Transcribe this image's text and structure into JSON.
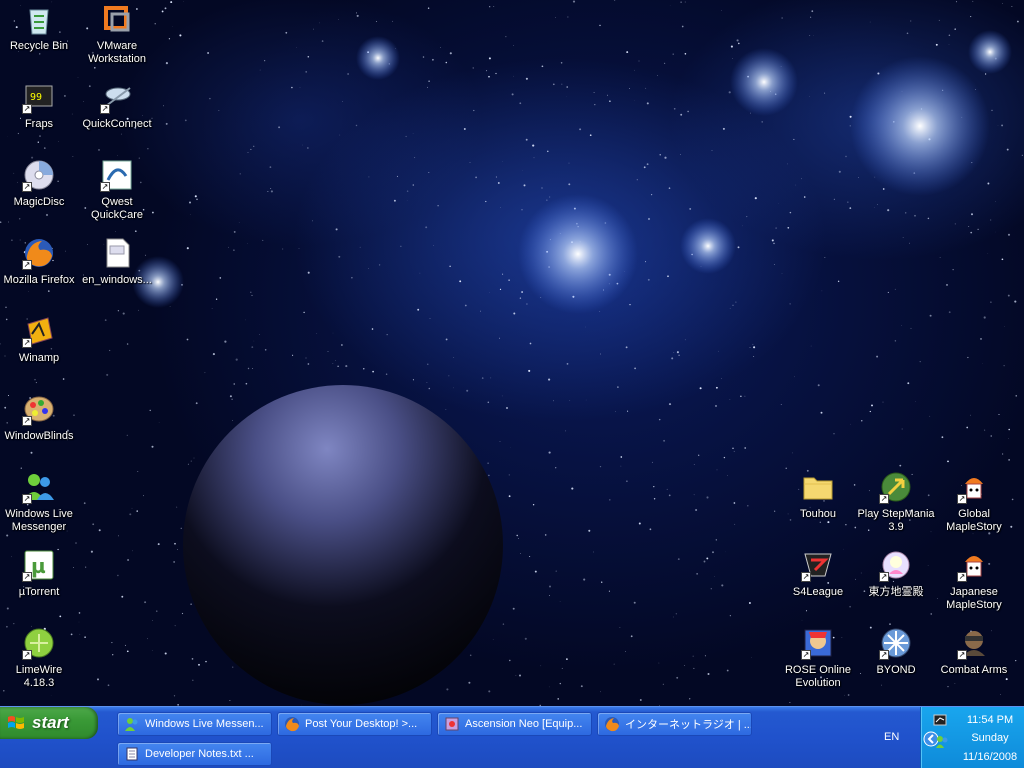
{
  "desktop": {
    "icons": [
      {
        "label": "Recycle Bin",
        "icon": "recycle-bin-icon",
        "shortcut": false
      },
      {
        "label": "VMware Workstation",
        "icon": "vmware-icon",
        "shortcut": false
      },
      {
        "label": "Fraps",
        "icon": "fraps-icon",
        "shortcut": true
      },
      {
        "label": "QuickConnect",
        "icon": "quickconnect-icon",
        "shortcut": true
      },
      {
        "label": "MagicDisc",
        "icon": "magicdisc-icon",
        "shortcut": true
      },
      {
        "label": "Qwest QuickCare",
        "icon": "qwest-icon",
        "shortcut": true
      },
      {
        "label": "Mozilla Firefox",
        "icon": "firefox-icon",
        "shortcut": true
      },
      {
        "label": "en_windows...",
        "icon": "document-icon",
        "shortcut": false
      },
      {
        "label": "Winamp",
        "icon": "winamp-icon",
        "shortcut": true
      },
      {
        "label": "WindowBlinds",
        "icon": "windowblinds-icon",
        "shortcut": true
      },
      {
        "label": "Windows Live Messenger",
        "icon": "messenger-icon",
        "shortcut": true
      },
      {
        "label": "µTorrent",
        "icon": "utorrent-icon",
        "shortcut": true
      },
      {
        "label": "LimeWire 4.18.3",
        "icon": "limewire-icon",
        "shortcut": true
      },
      {
        "label": "Touhou",
        "icon": "folder-icon",
        "shortcut": false
      },
      {
        "label": "Play StepMania 3.9",
        "icon": "stepmania-icon",
        "shortcut": true
      },
      {
        "label": "Global MapleStory",
        "icon": "maplestory-icon",
        "shortcut": true
      },
      {
        "label": "S4League",
        "icon": "s4league-icon",
        "shortcut": true
      },
      {
        "label": "東方地霊殿",
        "icon": "touhou-game-icon",
        "shortcut": true
      },
      {
        "label": "Japanese MapleStory",
        "icon": "maplestory-icon",
        "shortcut": true
      },
      {
        "label": "ROSE Online Evolution",
        "icon": "rose-online-icon",
        "shortcut": true
      },
      {
        "label": "BYOND",
        "icon": "byond-icon",
        "shortcut": true
      },
      {
        "label": "Combat Arms",
        "icon": "combat-arms-icon",
        "shortcut": true
      }
    ]
  },
  "taskbar": {
    "start_label": "start",
    "tasks": [
      {
        "label": "Windows Live Messen...",
        "icon": "messenger-icon"
      },
      {
        "label": "Post Your Desktop! >...",
        "icon": "firefox-icon"
      },
      {
        "label": "Ascension Neo [Equip...",
        "icon": "app-icon"
      },
      {
        "label": "インターネットラジオ | ...",
        "icon": "firefox-icon"
      },
      {
        "label": "Developer Notes.txt ...",
        "icon": "notepad-icon"
      }
    ],
    "language": "EN",
    "clock": {
      "time": "11:54 PM",
      "day": "Sunday",
      "date": "11/16/2008"
    }
  },
  "colors": {
    "taskbar": "#2052cc",
    "start_button": "#3a9a37",
    "tray": "#0e8ad9"
  }
}
